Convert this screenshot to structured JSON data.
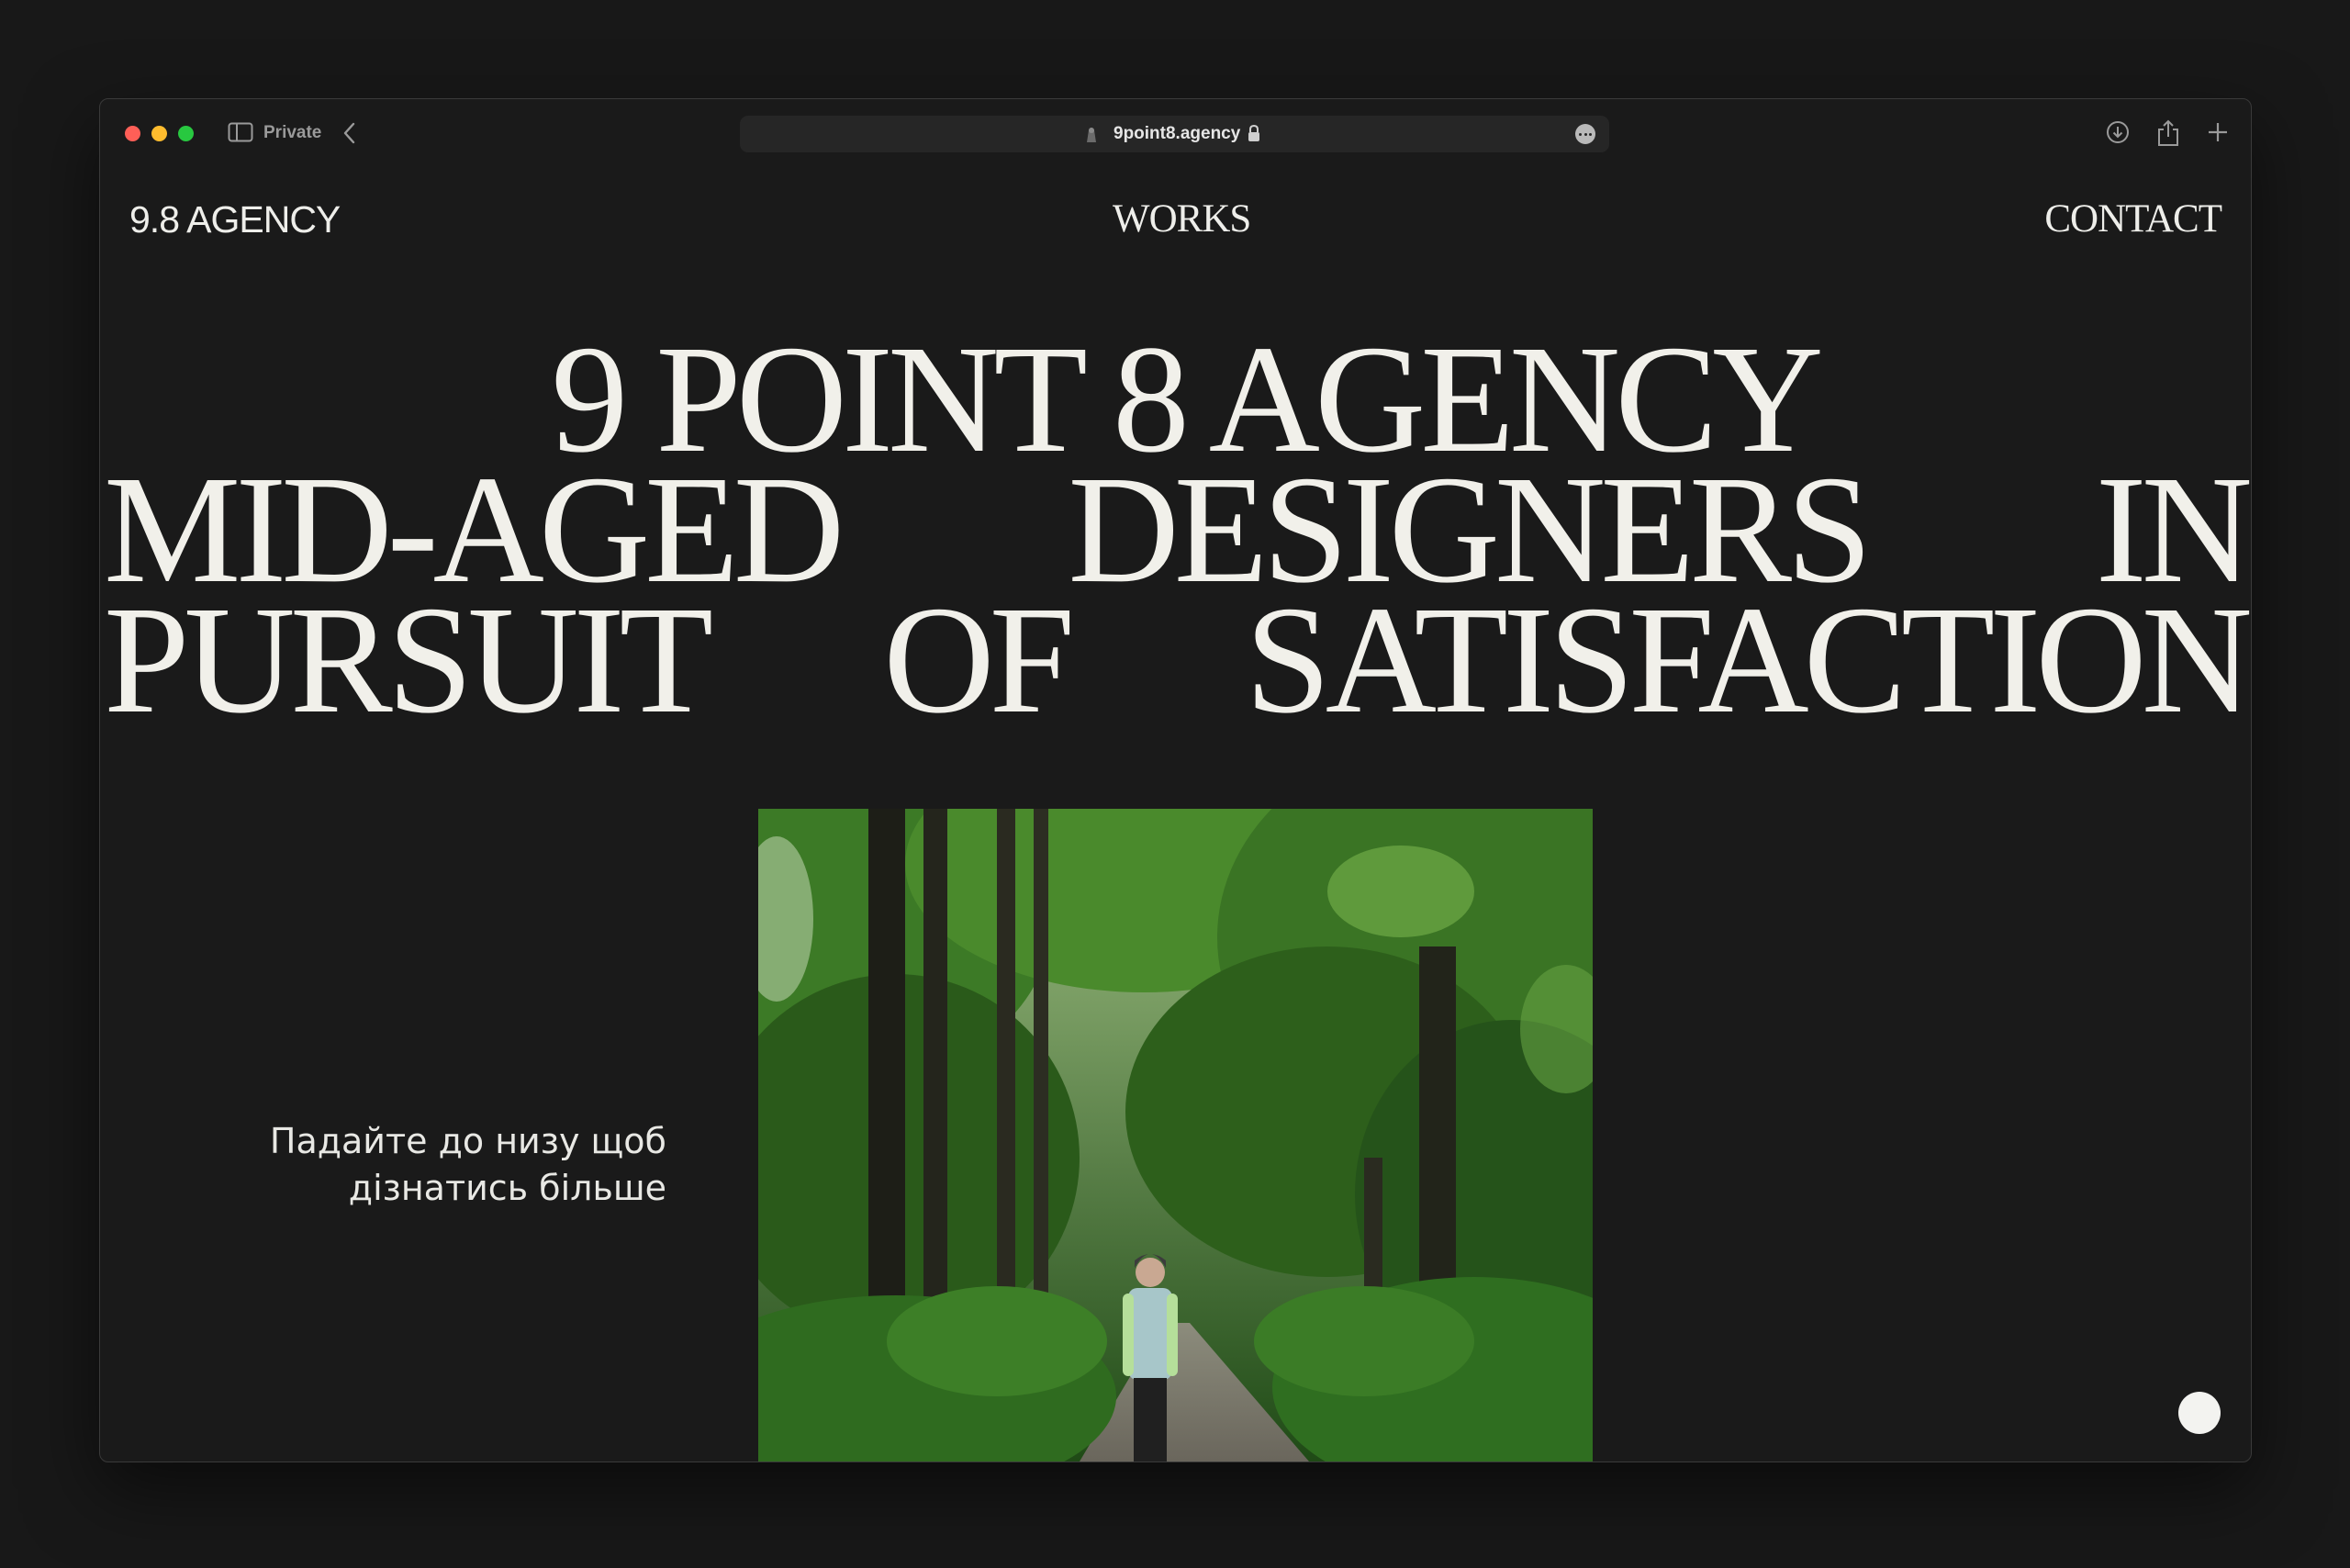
{
  "browser": {
    "mode_label": "Private",
    "url": "9point8.agency"
  },
  "nav": {
    "brand": "9.8 AGENCY",
    "works": "WORKS",
    "contact": "CONTACT"
  },
  "hero": {
    "line1": "9 POINT 8 AGENCY",
    "line2": [
      "MID-AGED",
      "DESIGNERS",
      "IN"
    ],
    "line3": [
      "PURSUIT",
      "OF",
      "SATISFACTION"
    ]
  },
  "scroll_hint": {
    "line1": "Падайте до низу щоб",
    "line2": "дізнатись більше"
  },
  "photo": {
    "icon": "forest-path-portrait-photo"
  },
  "colors": {
    "background": "#1a1a1a",
    "text": "#f1f0ea",
    "foliage": "#2f6b1f"
  }
}
